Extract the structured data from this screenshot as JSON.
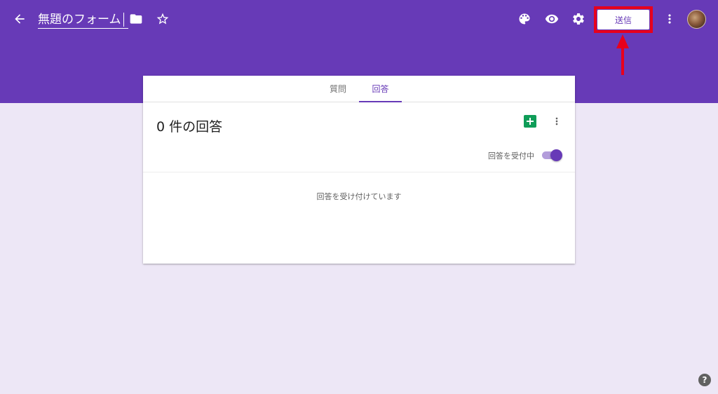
{
  "header": {
    "form_title": "無題のフォーム",
    "send_label": "送信",
    "icons": [
      "back-arrow-icon",
      "folder-icon",
      "star-icon",
      "palette-icon",
      "eye-icon",
      "gear-icon",
      "more-vert-icon",
      "avatar"
    ]
  },
  "tabs": [
    {
      "label": "質問",
      "active": false
    },
    {
      "label": "回答",
      "active": true
    }
  ],
  "responses": {
    "count_title": "0 件の回答",
    "accepting_label": "回答を受付中",
    "accepting_on": true,
    "accepting_message": "回答を受け付けています"
  },
  "help": {
    "label": "?"
  },
  "colors": {
    "brand": "#673ab7",
    "background": "#ede7f6",
    "highlight": "#e8001c",
    "sheets_green": "#0f9d58"
  }
}
